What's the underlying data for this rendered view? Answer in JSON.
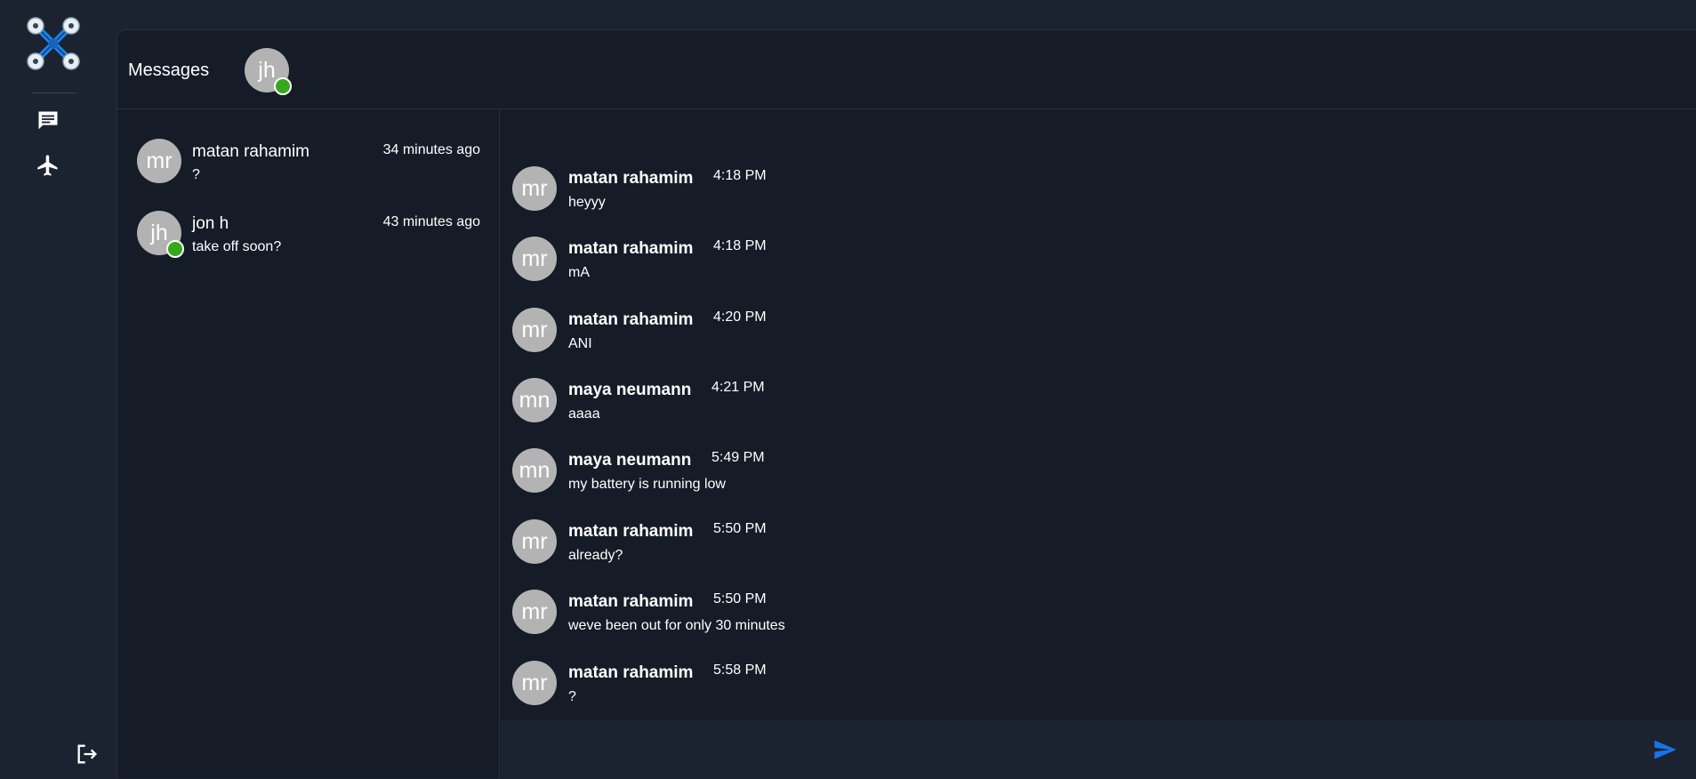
{
  "header": {
    "title": "Messages",
    "active_user_initials": "jh"
  },
  "icons": {
    "logo": "drone-logo-icon",
    "chat": "chat-icon",
    "flights": "airplane-icon",
    "logout": "logout-icon",
    "send": "send-icon"
  },
  "colors": {
    "online": "#36a81c",
    "accent": "#1a73e8",
    "avatar": "#b3b3b3"
  },
  "conversations": [
    {
      "initials": "mr",
      "name": "matan rahamim",
      "preview": "?",
      "time": "34 minutes ago",
      "online": false
    },
    {
      "initials": "jh",
      "name": "jon h",
      "preview": "take off soon?",
      "time": "43 minutes ago",
      "online": true
    }
  ],
  "messages": [
    {
      "initials": "mr",
      "author": "matan rahamim",
      "time": "4:18 PM",
      "text": "heyyy"
    },
    {
      "initials": "mr",
      "author": "matan rahamim",
      "time": "4:18 PM",
      "text": "mA"
    },
    {
      "initials": "mr",
      "author": "matan rahamim",
      "time": "4:20 PM",
      "text": "ANI"
    },
    {
      "initials": "mn",
      "author": "maya neumann",
      "time": "4:21 PM",
      "text": "aaaa"
    },
    {
      "initials": "mn",
      "author": "maya neumann",
      "time": "5:49 PM",
      "text": "my battery is running low"
    },
    {
      "initials": "mr",
      "author": "matan rahamim",
      "time": "5:50 PM",
      "text": "already?"
    },
    {
      "initials": "mr",
      "author": "matan rahamim",
      "time": "5:50 PM",
      "text": "weve been out for only 30 minutes"
    },
    {
      "initials": "mr",
      "author": "matan rahamim",
      "time": "5:58 PM",
      "text": "?"
    }
  ],
  "composer": {
    "placeholder": ""
  }
}
